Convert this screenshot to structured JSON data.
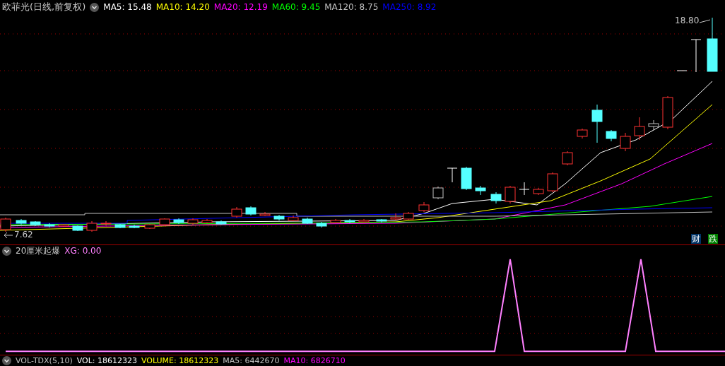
{
  "title": "欧菲光(日线,前复权)",
  "moving_averages": [
    {
      "label": "MA5:",
      "value": "15.48",
      "color": "#ffffff"
    },
    {
      "label": "MA10:",
      "value": "14.20",
      "color": "#ffff00"
    },
    {
      "label": "MA20:",
      "value": "12.19",
      "color": "#ff00ff"
    },
    {
      "label": "MA60:",
      "value": "9.45",
      "color": "#00ff00"
    },
    {
      "label": "MA120:",
      "value": "8.75",
      "color": "#c0c0c0"
    },
    {
      "label": "MA250:",
      "value": "8.92",
      "color": "#0000ff"
    }
  ],
  "price_high": "18.80",
  "price_low": "7.62",
  "badges": [
    {
      "text": "财",
      "color": "#003366"
    },
    {
      "text": "跌",
      "color": "#008000"
    }
  ],
  "indicator": {
    "name": "20厘米起爆",
    "reading": "XG: 0.00"
  },
  "volume_items": [
    {
      "text": "VOL-TDX(5,10)",
      "color": "#c0c0c0"
    },
    {
      "text": "VOL: 18612323",
      "color": "#ffffff"
    },
    {
      "text": "VOLUME: 18612323",
      "color": "#ffff00"
    },
    {
      "text": "MA5: 6442670",
      "color": "#c0c0c0"
    },
    {
      "text": "MA10: 6826710",
      "color": "#ff00ff"
    }
  ]
}
